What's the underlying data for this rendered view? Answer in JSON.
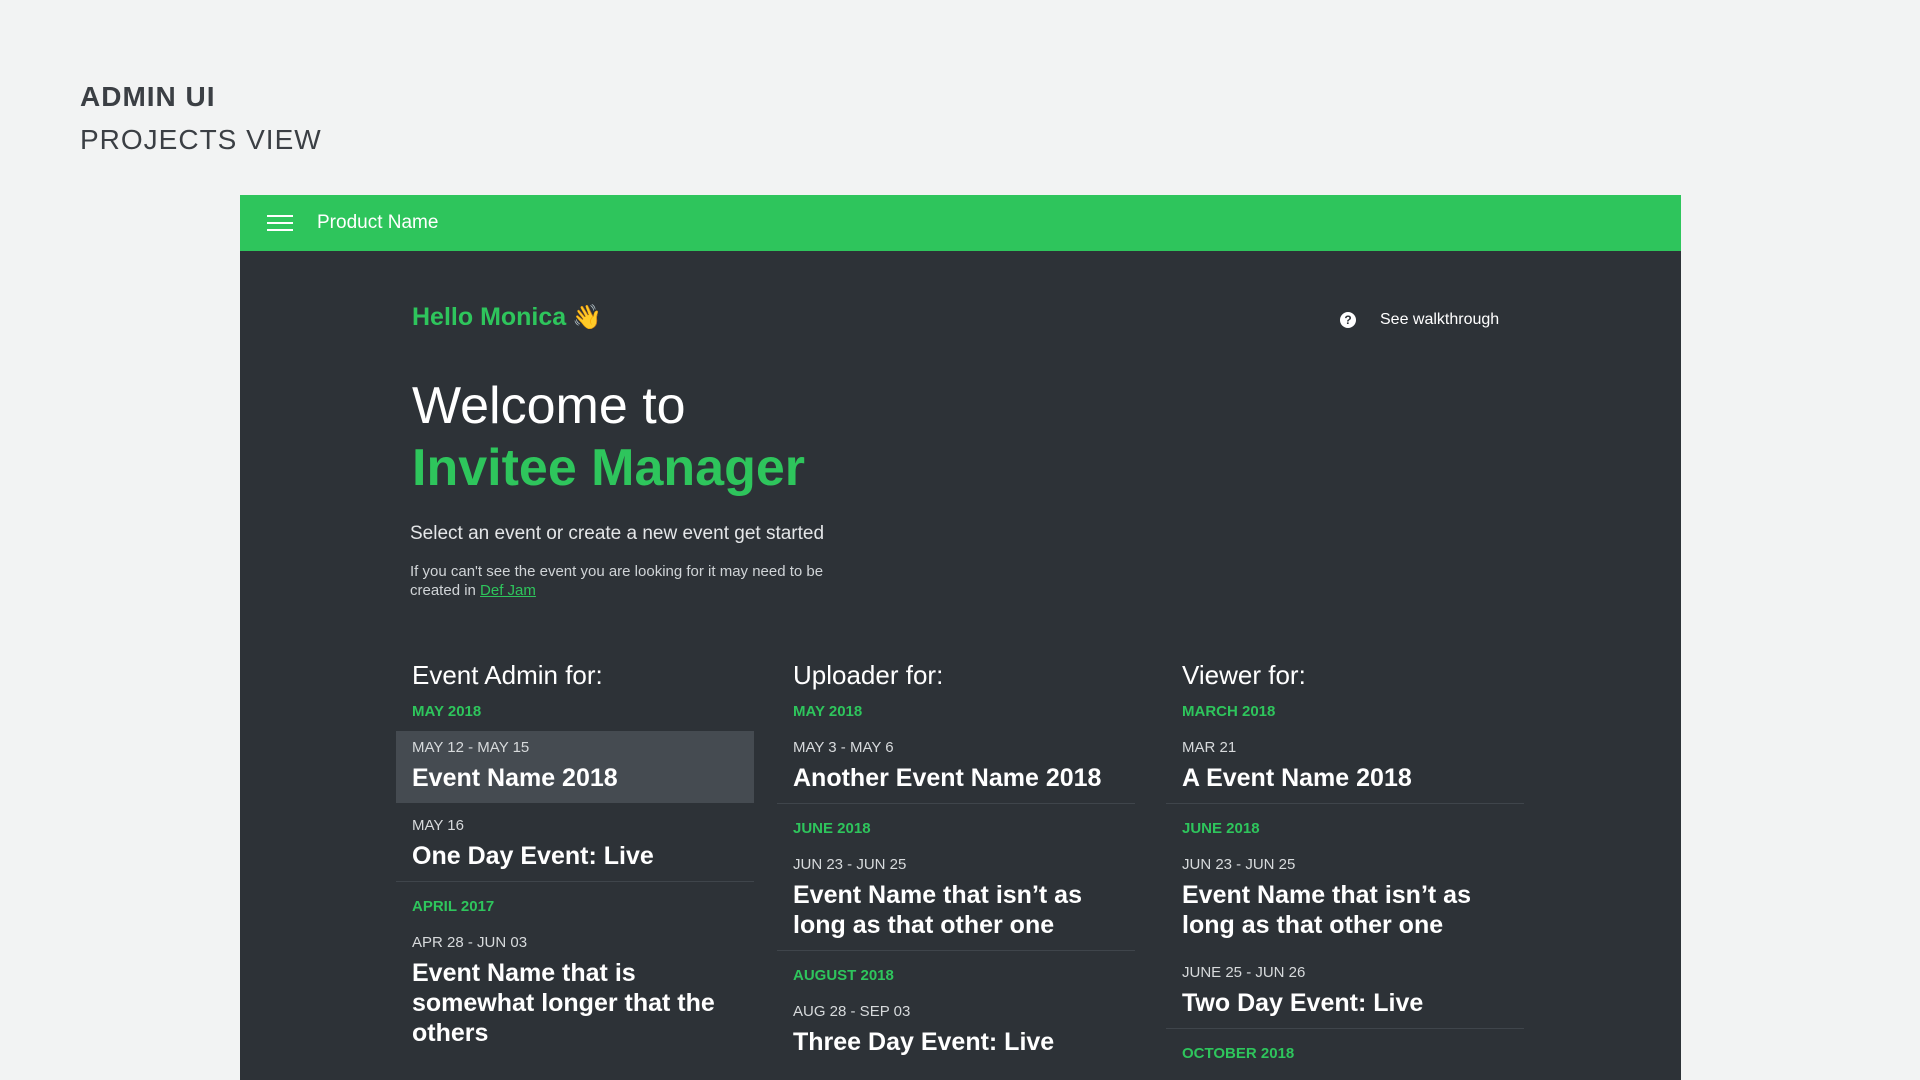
{
  "presentation": {
    "line1": "ADMIN UI",
    "line2": "PROJECTS VIEW"
  },
  "appbar": {
    "product_name": "Product Name",
    "menu_icon": "menu-icon"
  },
  "header": {
    "greeting": "Hello Monica",
    "wave_emoji": "👋",
    "walkthrough_label": "See walkthrough",
    "help_icon": "?"
  },
  "intro": {
    "welcome": "Welcome to",
    "product": "Invitee Manager",
    "subtitle": "Select an event or create a new event get started",
    "note": "If you can't see the event you are looking for it may need to be created in",
    "link": "Def Jam"
  },
  "columns": [
    {
      "heading": "Event Admin for:",
      "groups": [
        {
          "month": "MAY 2018",
          "events": [
            {
              "date": "MAY 12 - MAY 15",
              "name": "Event Name 2018"
            },
            {
              "date": "MAY 16",
              "name": "One Day Event: Live"
            }
          ]
        },
        {
          "month": "APRIL 2017",
          "events": [
            {
              "date": "APR 28 - JUN 03",
              "name": "Event Name that is somewhat longer that the others"
            }
          ]
        }
      ]
    },
    {
      "heading": "Uploader for:",
      "groups": [
        {
          "month": "MAY 2018",
          "events": [
            {
              "date": "MAY 3 - MAY 6",
              "name": "Another Event Name 2018"
            }
          ]
        },
        {
          "month": "JUNE 2018",
          "events": [
            {
              "date": "JUN 23 - JUN 25",
              "name": "Event Name that isn’t as long as that other one"
            }
          ]
        },
        {
          "month": "AUGUST 2018",
          "events": [
            {
              "date": "AUG 28 - SEP 03",
              "name": "Three Day Event: Live"
            }
          ]
        }
      ]
    },
    {
      "heading": "Viewer for:",
      "groups": [
        {
          "month": "MARCH 2018",
          "events": [
            {
              "date": "MAR 21",
              "name": "A Event Name 2018"
            }
          ]
        },
        {
          "month": "JUNE 2018",
          "events": [
            {
              "date": "JUN 23 - JUN 25",
              "name": "Event Name that isn’t as long as that other one"
            },
            {
              "date": "JUNE 25 - JUN 26",
              "name": "Two Day Event: Live"
            }
          ]
        },
        {
          "month": "OCTOBER 2018",
          "events": []
        }
      ]
    }
  ]
}
